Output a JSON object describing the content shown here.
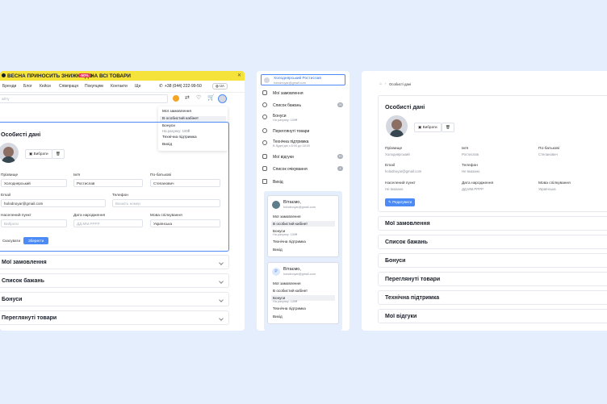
{
  "colors": {
    "background": "#e4eefc",
    "accent": "#4c8bf5",
    "promo": "#f5e23a",
    "sale": "#e8335a"
  },
  "left": {
    "promo": {
      "text1": "ВЕСНА ПРИНОСИТЬ ЗНИЖКИ ДО",
      "pct": "-50%",
      "text2": "НА ВСІ ТОВАРИ"
    },
    "nav": [
      "Бренди",
      "Блог",
      "Кейси",
      "Співпраця",
      "Покупцям",
      "Контакти",
      "Ще"
    ],
    "phone": "+38 (044) 222-99-50",
    "lang": "UA",
    "search_placeholder": "айту",
    "dropdown": [
      {
        "label": "Мої замовлення"
      },
      {
        "label": "В особистий кабінет"
      },
      {
        "label": "Бонуси",
        "sub": "На рахунку: 100₴"
      },
      {
        "label": "Технічна підтримка"
      },
      {
        "label": "Вихід"
      }
    ],
    "personal": {
      "title": "Особисті дані",
      "choose": "Вибрати",
      "surname_label": "Прізвище",
      "surname": "Холоднярський",
      "name_label": "Ім'я",
      "name": "Ростислав",
      "patronymic_label": "По-батькові",
      "patronymic": "Степанович",
      "email_label": "Email",
      "email": "holodnoyar@gmail.com",
      "phone_label": "Телефон",
      "phone_ph": "Вкажіть номер",
      "city_label": "Населений пункт",
      "city_ph": "Вибрати",
      "dob_label": "Дата народження",
      "dob_ph": "ДД.ММ.РРРР",
      "lang_label": "Мова спілкування",
      "lang": "Українська",
      "cancel": "Скасувати",
      "save": "Зберегти"
    },
    "sections": [
      "Мої замовлення",
      "Список бажань",
      "Бонуси",
      "Переглянуті товари"
    ]
  },
  "middle": {
    "user": {
      "name": "Холоднярський Ростислав",
      "email": "holodnoyar@gmail.com"
    },
    "menu": [
      {
        "label": "Мої замовлення"
      },
      {
        "label": "Список бажань",
        "badge": "26"
      },
      {
        "label": "Бонуси",
        "sub": "На рахунку: 100₴"
      },
      {
        "label": "Переглянуті товари"
      },
      {
        "label": "Технічна підтримка",
        "sub": "В будні дні з 8:00 до 18:00"
      },
      {
        "label": "Мої відгуки",
        "badge": "10"
      },
      {
        "label": "Список очікування",
        "badge": "4"
      },
      {
        "label": "Вихід"
      }
    ],
    "card1": {
      "greet": "Вітаємо,",
      "email": "holodnoyar@gmail.com",
      "rows": [
        "Мої замовлення",
        "В особистий кабінет",
        "Бонуси",
        "Технічна підтримка",
        "Вихід"
      ],
      "bonus_sub": "На рахунку: 100₴"
    },
    "card2": {
      "greet": "Вітаємо,",
      "initial": "Р",
      "email": "holodnoyar@gmail.com",
      "rows": [
        "Мої замовлення",
        "В особистий кабінет",
        "Бонуси",
        "Технічна підтримка",
        "Вихід"
      ],
      "bonus_sub": "На рахунку: 100₴"
    }
  },
  "right": {
    "breadcrumb": "Особисті дані",
    "title": "Особисті дані",
    "choose": "Вибрати",
    "surname_label": "Прізвище",
    "surname": "Холоднярський",
    "name_label": "Ім'я",
    "name": "Ростислав",
    "patronymic_label": "По-батькові",
    "patronymic": "Степанович",
    "email_label": "Email",
    "email": "holodnoyar@gmail.com",
    "phone_label": "Телефон",
    "phone": "Не вказано",
    "city_label": "Населений пункт",
    "city": "Не вказано",
    "dob_label": "Дата народження",
    "dob": "ДД.ММ.РРРР",
    "lang_label": "Мова спілкування",
    "lang": "Українська",
    "edit": "Редагувати",
    "sections": [
      "Мої замовлення",
      "Список бажань",
      "Бонуси",
      "Переглянуті товари",
      "Технічна підтримка",
      "Мої відгуки"
    ]
  }
}
